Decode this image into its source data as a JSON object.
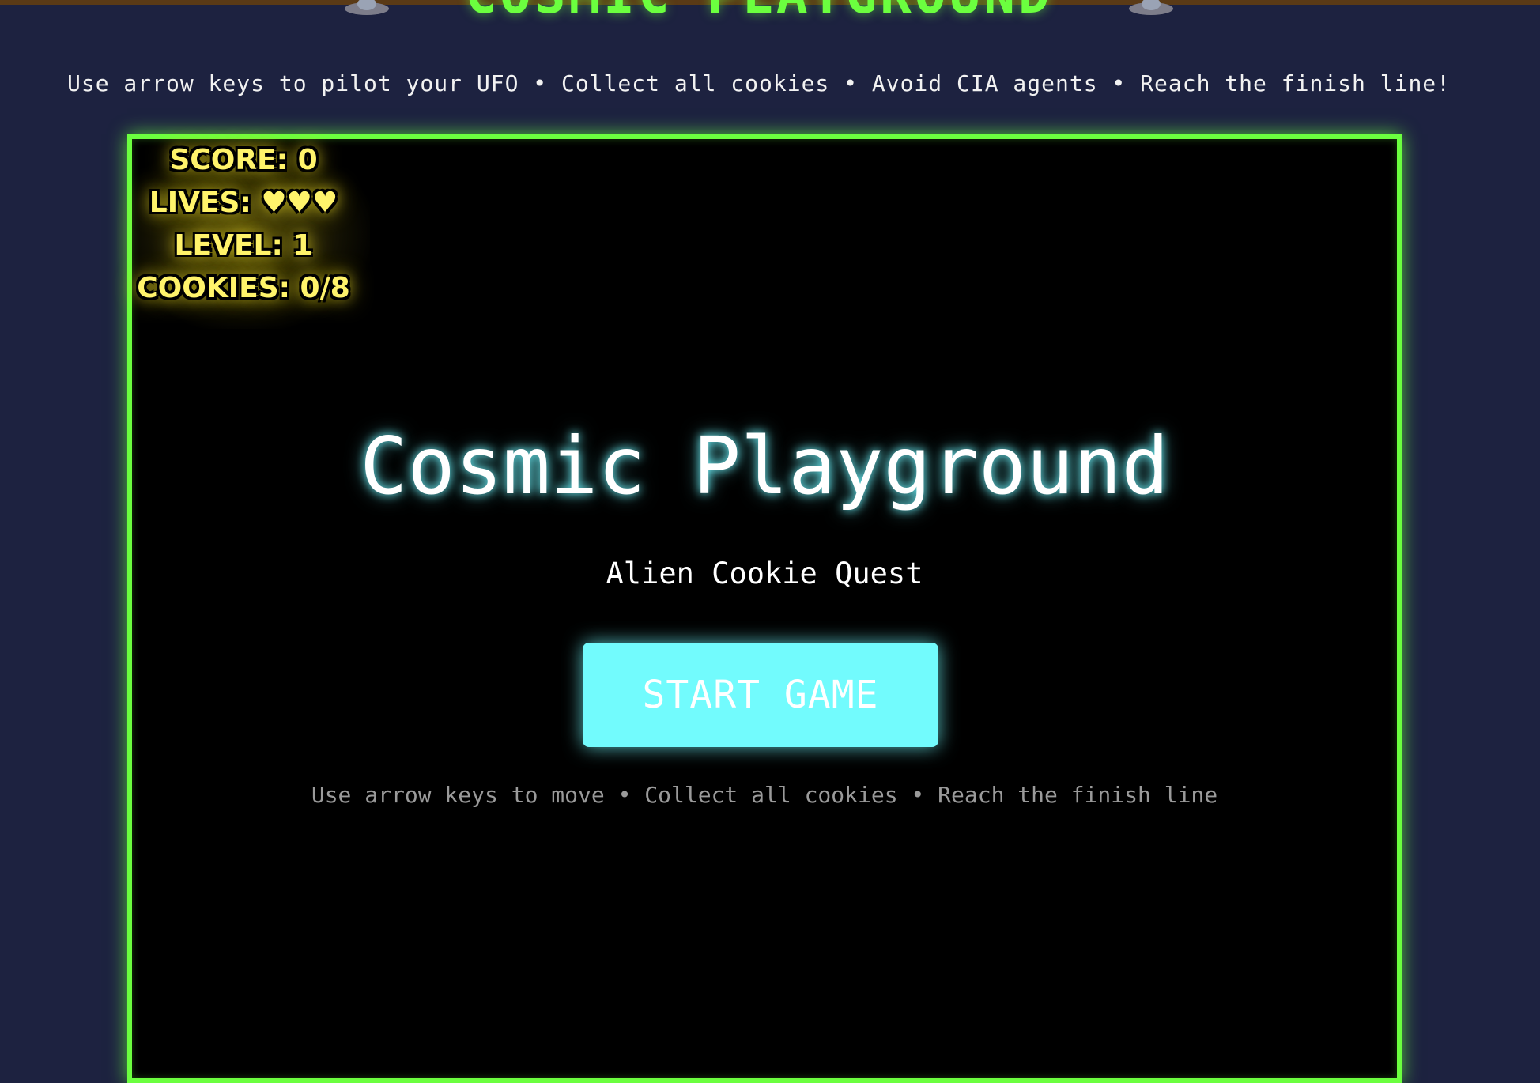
{
  "header": {
    "title": "COSMIC PLAYGROUND",
    "subtitle": "Use arrow keys to pilot your UFO • Collect all cookies • Avoid CIA agents • Reach the finish line!",
    "decoration_icon": "ufo-icon"
  },
  "hud": {
    "score": "SCORE: 0",
    "lives": "LIVES: ♥♥♥",
    "level": "LEVEL: 1",
    "cookies": "COOKIES: 0/8"
  },
  "start_screen": {
    "title": "Cosmic Playground",
    "subtitle": "Alien Cookie Quest",
    "start_button_label": "START GAME",
    "hint": "Use arrow keys to move • Collect all cookies • Reach the finish line"
  },
  "colors": {
    "background": "#1d2240",
    "accent_green": "#6bff3f",
    "button_cyan": "#72fbfd",
    "hud_yellow": "#fff36b"
  }
}
